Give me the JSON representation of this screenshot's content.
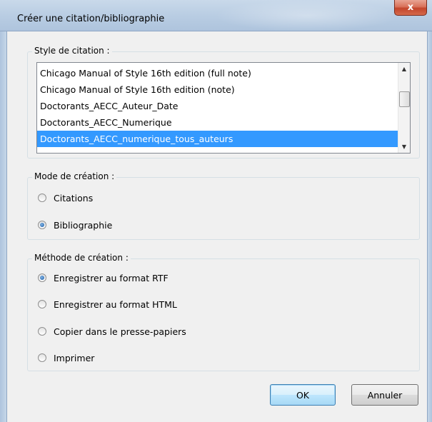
{
  "window": {
    "title": "Créer une citation/bibliographie",
    "close_glyph": "x"
  },
  "style_group": {
    "legend": "Style de citation :",
    "items": [
      "Chicago Manual of Style 16th edition (full note)",
      "Chicago Manual of Style 16th edition (note)",
      "Doctorants_AECC_Auteur_Date",
      "Doctorants_AECC_Numerique",
      "Doctorants_AECC_numerique_tous_auteurs"
    ],
    "selected_index": 4
  },
  "mode_group": {
    "legend": "Mode de création :",
    "options": [
      "Citations",
      "Bibliographie"
    ],
    "selected_index": 1
  },
  "method_group": {
    "legend": "Méthode de création :",
    "options": [
      "Enregistrer au format RTF",
      "Enregistrer au format HTML",
      "Copier dans le presse-papiers",
      "Imprimer"
    ],
    "selected_index": 0
  },
  "buttons": {
    "ok": "OK",
    "cancel": "Annuler"
  },
  "colors": {
    "selection": "#3399ff",
    "dialog_bg": "#f0f0f0"
  }
}
